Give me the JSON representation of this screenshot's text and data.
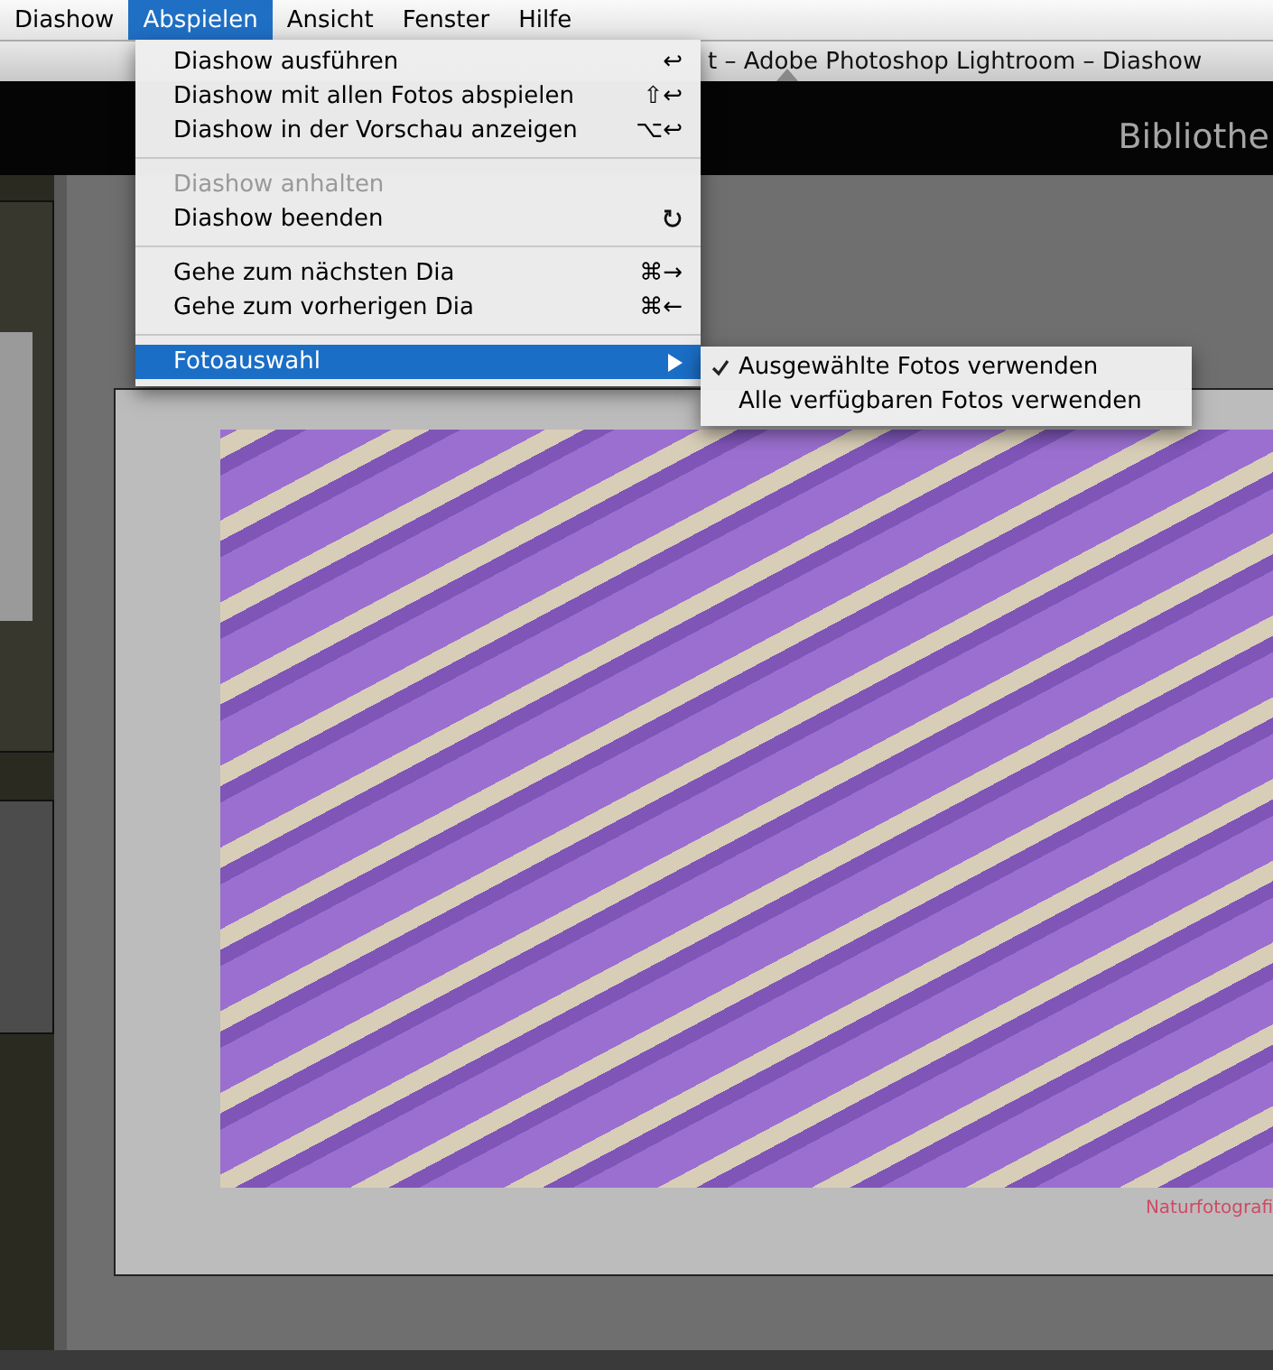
{
  "menubar": [
    {
      "label": "Diashow",
      "selected": false
    },
    {
      "label": "Abspielen",
      "selected": true
    },
    {
      "label": "Ansicht",
      "selected": false
    },
    {
      "label": "Fenster",
      "selected": false
    },
    {
      "label": "Hilfe",
      "selected": false
    }
  ],
  "window": {
    "title": "t – Adobe Photoshop Lightroom – Diashow"
  },
  "toolbar": {
    "module": "Bibliothe"
  },
  "menu": {
    "items": [
      {
        "kind": "item",
        "label": "Diashow ausführen",
        "shortcut": "↩",
        "disabled": false,
        "selected": false
      },
      {
        "kind": "item",
        "label": "Diashow mit allen Fotos abspielen",
        "shortcut": "⇧↩",
        "disabled": false,
        "selected": false
      },
      {
        "kind": "item",
        "label": "Diashow in der Vorschau anzeigen",
        "shortcut": "⌥↩",
        "disabled": false,
        "selected": false
      },
      {
        "kind": "separator"
      },
      {
        "kind": "item",
        "label": "Diashow anhalten",
        "disabled": true,
        "selected": false
      },
      {
        "kind": "item",
        "label": "Diashow beenden",
        "escape_shortcut": true,
        "disabled": false,
        "selected": false
      },
      {
        "kind": "separator"
      },
      {
        "kind": "item",
        "label": "Gehe zum nächsten Dia",
        "shortcut": "⌘→",
        "disabled": false,
        "selected": false
      },
      {
        "kind": "item",
        "label": "Gehe zum vorherigen Dia",
        "shortcut": "⌘←",
        "disabled": false,
        "selected": false
      },
      {
        "kind": "separator"
      },
      {
        "kind": "submenu",
        "label": "Fotoauswahl",
        "disabled": false,
        "selected": true
      }
    ]
  },
  "submenu": {
    "items": [
      {
        "label": "Ausgewählte Fotos verwenden",
        "checked": true
      },
      {
        "label": "Alle verfügbaren Fotos verwenden",
        "checked": false
      }
    ]
  },
  "slide": {
    "watermark": "Naturfotografi"
  }
}
